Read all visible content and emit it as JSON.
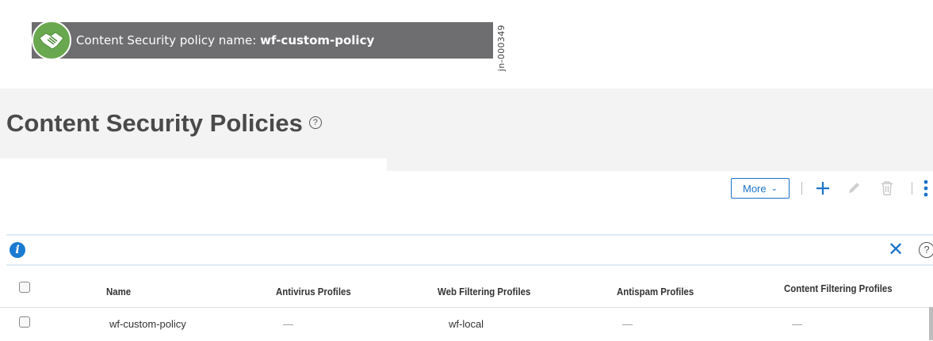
{
  "banner": {
    "label": "Content Security policy name: ",
    "value": "wf-custom-policy",
    "id_tag": "jn-000349"
  },
  "page": {
    "title": "Content Security Policies",
    "help_glyph": "?"
  },
  "toolbar": {
    "more_label": "More",
    "more_chevron": "⌄"
  },
  "infobar": {
    "info_glyph": "i",
    "close_glyph": "✕",
    "help_glyph": "?"
  },
  "table": {
    "columns": [
      "Name",
      "Antivirus Profiles",
      "Web Filtering Profiles",
      "Antispam Profiles",
      "Content Filtering Profiles"
    ],
    "rows": [
      [
        "wf-custom-policy",
        "—",
        "wf-local",
        "—",
        "—"
      ]
    ]
  },
  "colors": {
    "accent": "#1a73c7",
    "banner_bg": "#6e6e70",
    "banner_icon": "#69a84f"
  }
}
